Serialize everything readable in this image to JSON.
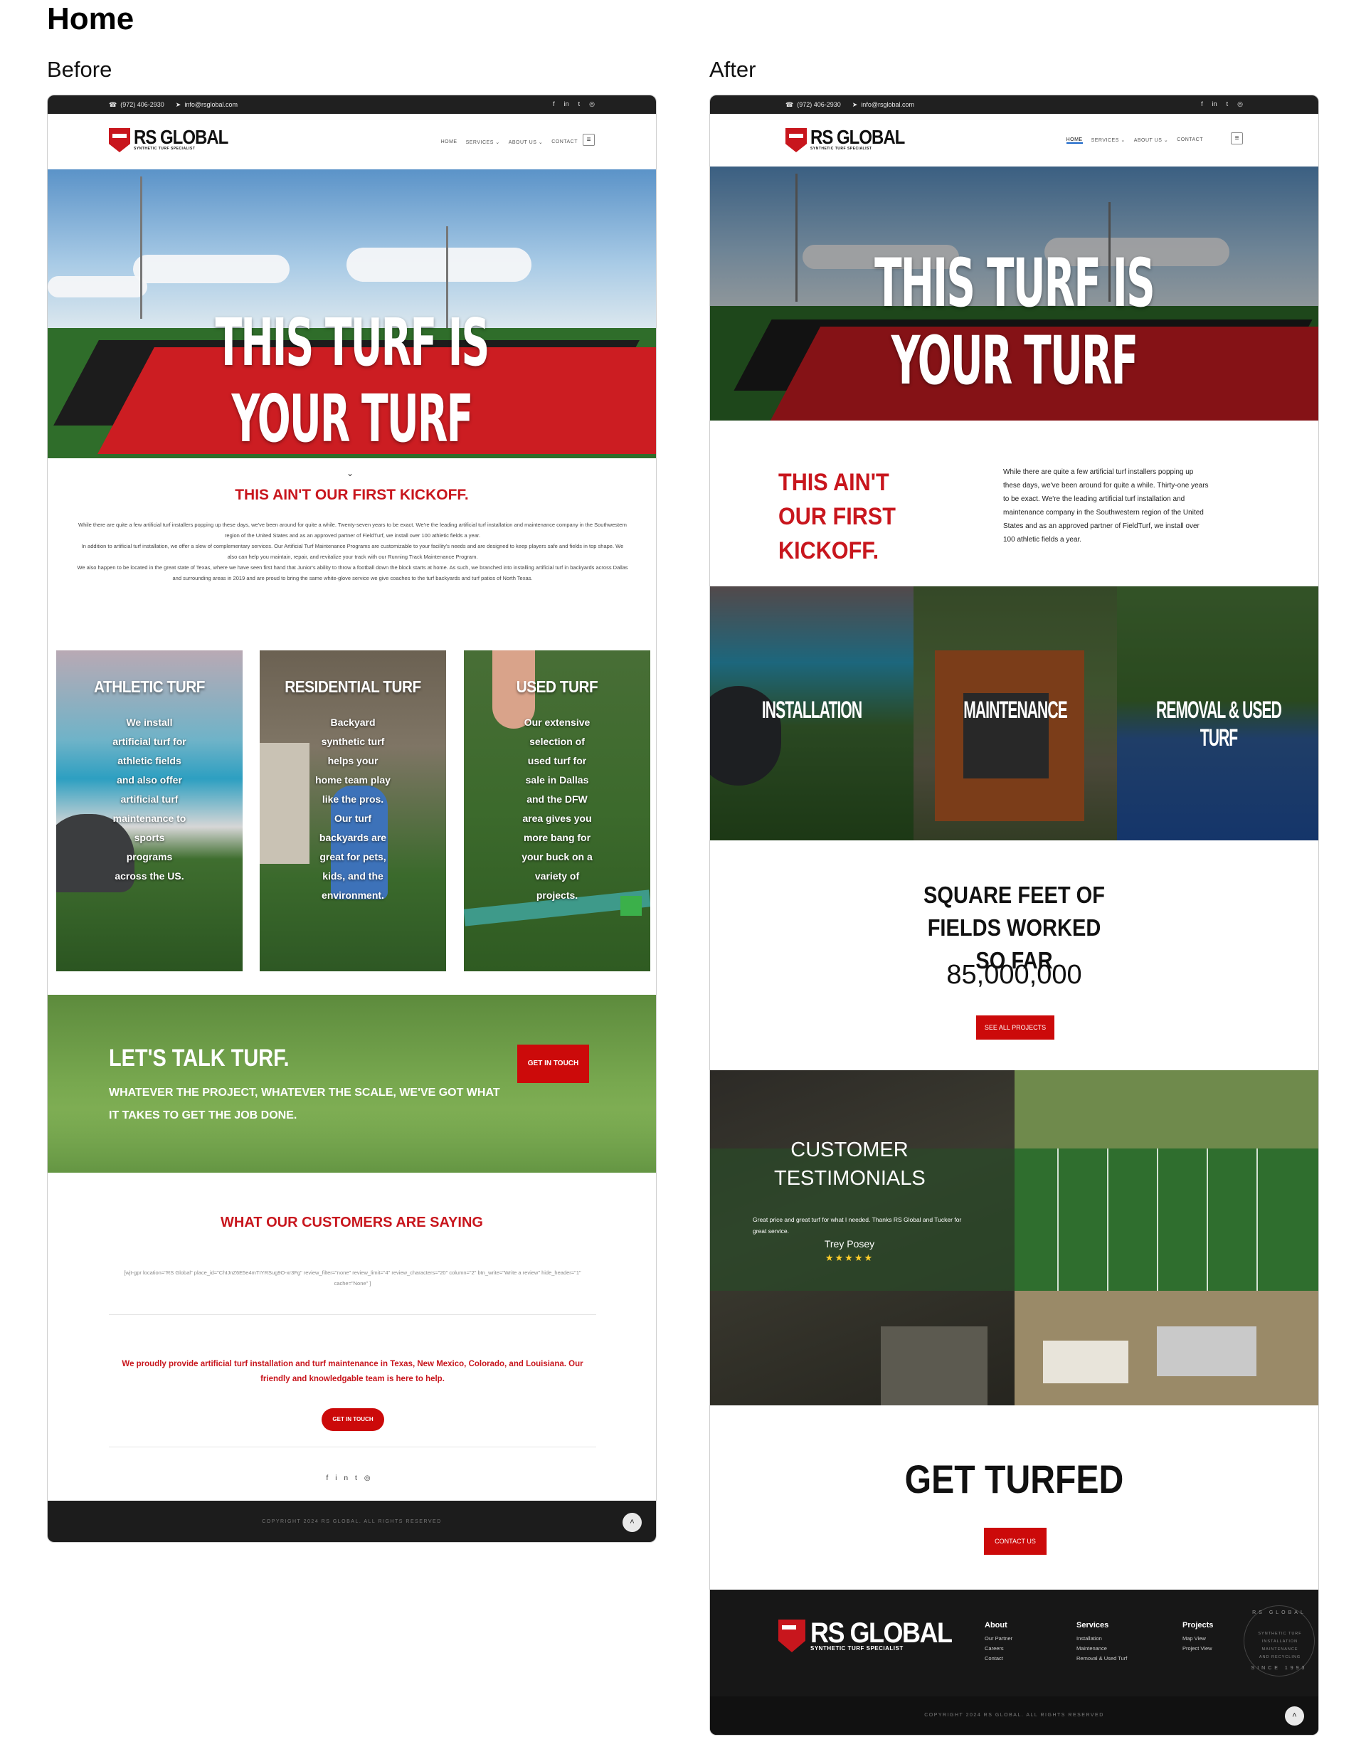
{
  "page": {
    "title": "Home"
  },
  "columns": {
    "before": "Before",
    "after": "After"
  },
  "topbar": {
    "phone": "(972) 406-2930",
    "email": "info@rsglobal.com",
    "socials": [
      "f",
      "in",
      "t",
      "◎"
    ]
  },
  "logo": {
    "name": "RS GLOBAL",
    "tagline": "SYNTHETIC TURF SPECIALIST"
  },
  "nav": {
    "home": "HOME",
    "services": "SERVICES",
    "about": "ABOUT US",
    "contact": "CONTACT",
    "dropdown": "⌄",
    "menu_icon": "≡"
  },
  "hero": {
    "headline": "THIS TURF IS YOUR TURF",
    "scroll_icon": "⌄"
  },
  "before": {
    "kickoff_title": "THIS AIN'T OUR FIRST KICKOFF.",
    "intro_1": "While there are quite a few artificial turf installers popping up these days, we've been around for quite a while. Twenty-seven years to be exact. We're the leading artificial turf installation and maintenance company in the Southwestern region of the United States and as an approved partner of FieldTurf, we install over 100 athletic fields a year.",
    "intro_2": "In addition to artificial turf installation, we offer a slew of complementary services. Our Artificial Turf Maintenance Programs are customizable to your facility's needs and are designed to keep players safe and fields in top shape. We also can help you maintain, repair, and revitalize your track with our Running Track Maintenance Program.",
    "intro_3": "We also happen to be located in the great state of Texas, where we have seen first hand that Junior's ability to throw a football down the block starts at home. As such, we branched into installing artificial turf in backyards across Dallas and surrounding areas in 2019 and are proud to bring the same white-glove service we give coaches to the turf backyards and turf patios of North Texas.",
    "cards": [
      {
        "title": "ATHLETIC TURF",
        "body": "We install artificial turf for athletic fields and also offer artificial turf maintenance to sports programs across the US."
      },
      {
        "title": "RESIDENTIAL TURF",
        "body": "Backyard synthetic turf helps your home team play like the pros. Our turf backyards are great for pets, kids, and the environment."
      },
      {
        "title": "USED TURF",
        "body": "Our extensive selection of used turf for sale in Dallas and the DFW area gives you more bang for your buck on a variety of projects."
      }
    ],
    "talk_title": "LET'S TALK TURF.",
    "talk_subtitle": "WHATEVER THE PROJECT, WHATEVER THE SCALE, WE'VE GOT WHAT IT TAKES TO GET THE JOB DONE.",
    "talk_button": "GET IN TOUCH",
    "customers_title": "WHAT OUR CUSTOMERS ARE SAYING",
    "shortcode": "[wjt-gpr location=\"RS Global\" place_id=\"ChIJnZ6E5e4mTIYRSug9O-xr3Fg\" review_filter=\"none\" review_limit=\"4\" review_characters=\"20\" column=\"2\" btn_write=\"Write a review\" hide_header=\"1\" cache=\"None\" ]",
    "proud_text": "We proudly provide artificial turf installation and turf maintenance in Texas, New Mexico, Colorado, and Louisiana. Our friendly and knowledgable team is here to help.",
    "cta_button": "GET IN TOUCH",
    "socials": [
      "f",
      "in",
      "t",
      "◎"
    ],
    "copyright": "COPYRIGHT 2024 RS GLOBAL. ALL RIGHTS RESERVED",
    "up_icon": "˄"
  },
  "after": {
    "kickoff_title": "THIS AIN'T OUR FIRST KICKOFF.",
    "intro": "While there are quite a few artificial turf installers popping up these days, we've been around for quite a while. Thirty-one years to be exact. We're the leading artificial turf installation and maintenance company in the Southwestern region of the United States and as an approved partner of FieldTurf, we install over 100 athletic fields a year.",
    "tiles": [
      "INSTALLATION",
      "MAINTENANCE",
      "REMOVAL & USED TURF"
    ],
    "sqft_title": "SQUARE FEET OF FIELDS WORKED SO FAR",
    "sqft_count": "85,000,000",
    "projects_button": "SEE ALL PROJECTS",
    "testimonials_title": "CUSTOMER TESTIMONIALS",
    "testimonial_quote": "Great price and great turf for what I needed. Thanks RS Global and Tucker for great service.",
    "testimonial_name": "Trey Posey",
    "testimonial_stars": "★★★★★",
    "get_turfed": "GET TURFED",
    "contact_button": "CONTACT US",
    "footer": {
      "about_title": "About",
      "about_links": [
        "Our Partner",
        "Careers",
        "Contact"
      ],
      "services_title": "Services",
      "services_links": [
        "Installation",
        "Maintenance",
        "Removal & Used Turf"
      ],
      "projects_title": "Projects",
      "projects_links": [
        "Map View",
        "Project View"
      ],
      "badge_ring": "RS GLOBAL",
      "badge_lines": [
        "SYNTHETIC TURF",
        "INSTALLATION",
        "MAINTENANCE",
        "AND RECYCLING"
      ],
      "badge_since": "SINCE 1993"
    },
    "copyright": "COPYRIGHT 2024 RS GLOBAL. ALL RIGHTS RESERVED",
    "up_icon": "˄"
  },
  "colors": {
    "brand_red": "#c8161d",
    "button_red": "#cc0a0a",
    "dark": "#1c1c1c",
    "accent_blue": "#1a66c8"
  }
}
